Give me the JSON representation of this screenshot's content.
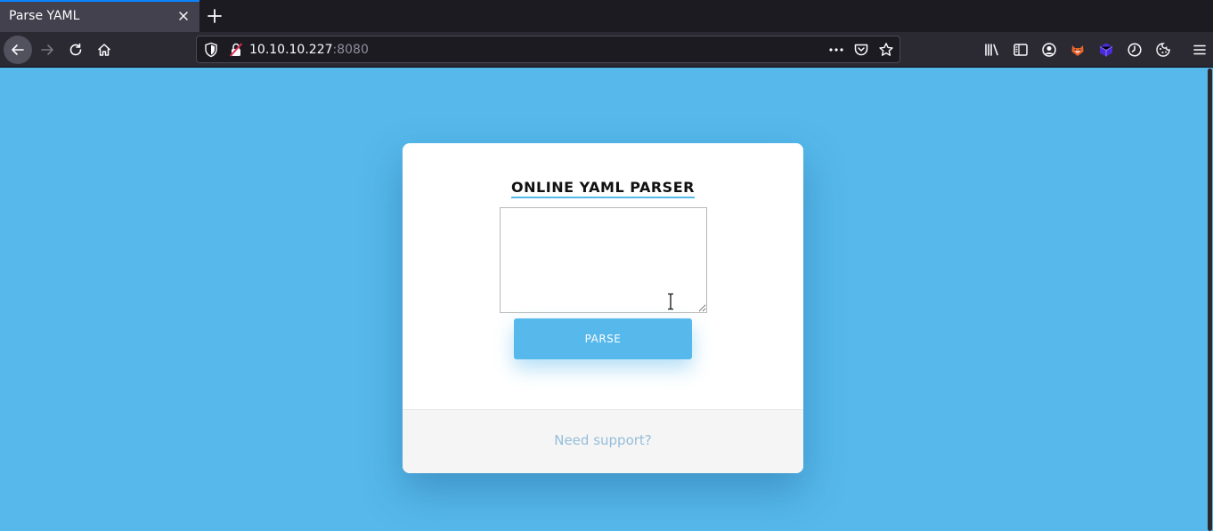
{
  "browser": {
    "tab_title": "Parse YAML",
    "url_host": "10.10.10.227",
    "url_port": ":8080"
  },
  "page": {
    "title": "ONLINE YAML PARSER",
    "textarea_value": "",
    "parse_label": "PARSE",
    "support_link": "Need support?"
  },
  "colors": {
    "page_background": "#56b8eb",
    "accent": "#56b8eb",
    "card": "#ffffff",
    "footer": "#f5f5f5",
    "link": "#95bedb"
  },
  "icons": {
    "toolbar": [
      "library-icon",
      "sidebar-icon",
      "account-icon",
      "extension-fox-icon",
      "extension-cube-icon",
      "history-clock-icon",
      "cookie-icon",
      "menu-icon"
    ]
  }
}
